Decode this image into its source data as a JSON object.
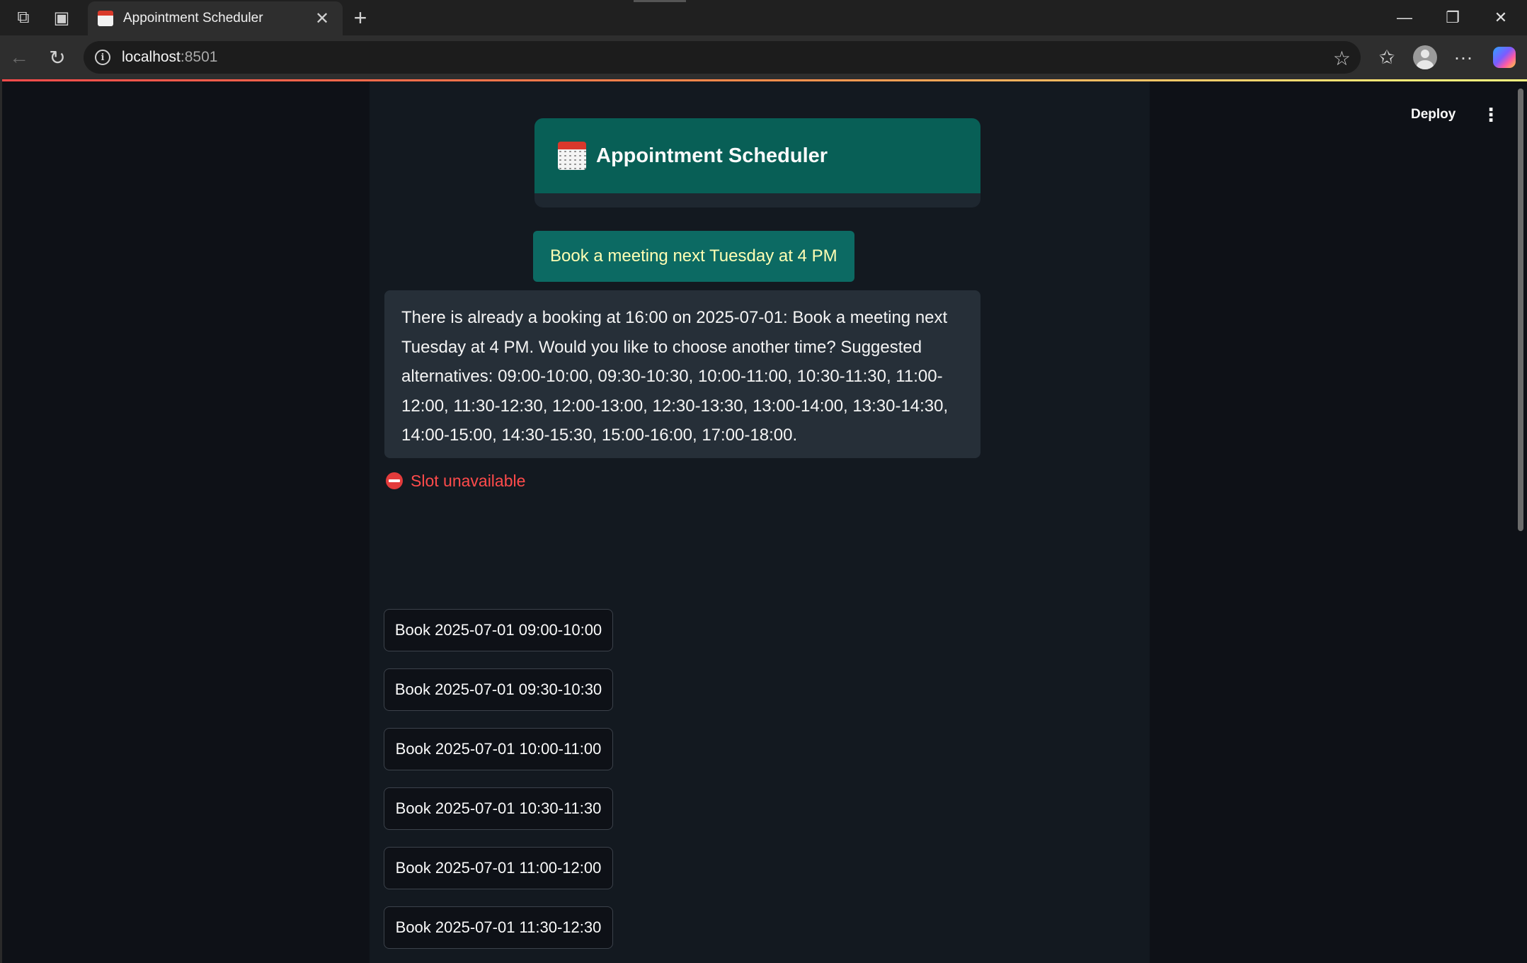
{
  "browser": {
    "tab_title": "Appointment Scheduler",
    "url_host": "localhost",
    "url_port": ":8501"
  },
  "toolbar": {
    "deploy_label": "Deploy"
  },
  "header": {
    "title": "Appointment Scheduler"
  },
  "chat": {
    "user_message": "Book a meeting next Tuesday at 4 PM",
    "assistant_message": "There is already a booking at 16:00 on 2025-07-01: Book a meeting next Tuesday at 4 PM. Would you like to choose another time? Suggested alternatives: 09:00-10:00, 09:30-10:30, 10:00-11:00, 10:30-11:30, 11:00-12:00, 11:30-12:30, 12:00-13:00, 12:30-13:30, 13:00-14:00, 13:30-14:30, 14:00-15:00, 14:30-15:30, 15:00-16:00, 17:00-18:00."
  },
  "status": {
    "error_text": "Slot unavailable",
    "error_color": "#ff4b4b"
  },
  "slots": [
    "Book 2025-07-01 09:00-10:00",
    "Book 2025-07-01 09:30-10:30",
    "Book 2025-07-01 10:00-11:00",
    "Book 2025-07-01 10:30-11:30",
    "Book 2025-07-01 11:00-12:00",
    "Book 2025-07-01 11:30-12:30"
  ],
  "colors": {
    "header_bg": "#085f56",
    "user_bubble_bg": "#0c6a63",
    "user_text": "#ffffb4",
    "assistant_bubble_bg": "#262f38",
    "page_bg": "#0e1117"
  }
}
